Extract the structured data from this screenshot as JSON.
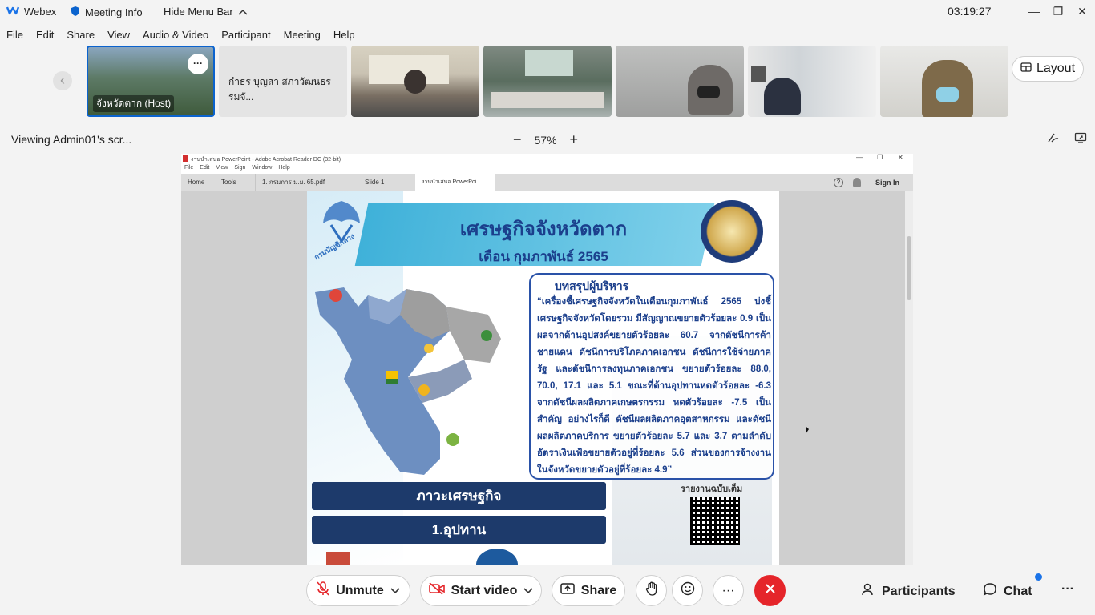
{
  "titlebar": {
    "app_name": "Webex",
    "meeting_info": "Meeting Info",
    "hide_menu": "Hide Menu Bar",
    "clock": "03:19:27",
    "minimize": "—",
    "restore": "❐",
    "close": "✕"
  },
  "menu": {
    "items": [
      "File",
      "Edit",
      "Share",
      "View",
      "Audio & Video",
      "Participant",
      "Meeting",
      "Help"
    ]
  },
  "filmstrip": {
    "prev": "‹",
    "host_name": "จังหวัดตาก (Host)",
    "host_more": "···",
    "second_name": "กำธร บุญสา สภาวัฒนธรรมจั...",
    "layout_label": "Layout"
  },
  "viewing": {
    "label": "Viewing Admin01's scr...",
    "zoom_minus": "−",
    "zoom_value": "57%",
    "zoom_plus": "+"
  },
  "acrobat": {
    "window_title": "งานนำเสนอ PowerPoint - Adobe Acrobat Reader DC (32-bit)",
    "menu": [
      "File",
      "Edit",
      "View",
      "Sign",
      "Window",
      "Help"
    ],
    "home": "Home",
    "tools": "Tools",
    "tab1": "1. กรมการ ม.ย. 65.pdf",
    "tab2": "Slide 1",
    "tab3": "งานนำเสนอ PowerPoi...",
    "sign_in": "Sign In"
  },
  "slide": {
    "title": "เศรษฐกิจจังหวัดตาก",
    "subtitle": "เดือน กุมภาพันธ์ 2565",
    "summary_title": "บทสรุปผู้บริหาร",
    "summary_text": "“เครื่องชี้เศรษฐกิจจังหวัดในเดือนกุมภาพันธ์ 2565 บ่งชี้เศรษฐกิจจังหวัดโดยรวม มีสัญญาณขยายตัวร้อยละ 0.9 เป็นผลจากด้านอุปสงค์ขยายตัวร้อยละ 60.7 จากดัชนีการค้าชายแดน ดัชนีการบริโภคภาคเอกชน ดัชนีการใช้จ่ายภาครัฐ และดัชนีการลงทุนภาคเอกชน ขยายตัวร้อยละ 88.0, 70.0, 17.1 และ 5.1 ขณะที่ด้านอุปทานหดตัวร้อยละ -6.3 จากดัชนีผลผลิตภาคเกษตรกรรม หดตัวร้อยละ -7.5 เป็นสำคัญ อย่างไรก็ดี ดัชนีผลผลิตภาคอุตสาหกรรม และดัชนีผลผลิตภาคบริการ ขยายตัวร้อยละ 5.7 และ 3.7 ตามลำดับ อัตราเงินเฟ้อขยายตัวอยู่ที่ร้อยละ 5.6 ส่วนของการจ้างงานในจังหวัดขยายตัวอยู่ที่ร้อยละ 4.9”",
    "button_economy": "ภาวะเศรษฐกิจ",
    "button_supply": "1.อุปทาน",
    "report_label": "รายงานฉบับเต็ม",
    "logo_caption": "กรมบัญชีกลาง"
  },
  "toolbar": {
    "unmute": "Unmute",
    "start_video": "Start video",
    "share": "Share",
    "more": "···",
    "participants": "Participants",
    "chat": "Chat"
  },
  "colors": {
    "end_call": "#e5252a",
    "webex_blue": "#0b63ce",
    "slide_navy": "#1d3a6b",
    "slide_text": "#1b3f8c"
  }
}
